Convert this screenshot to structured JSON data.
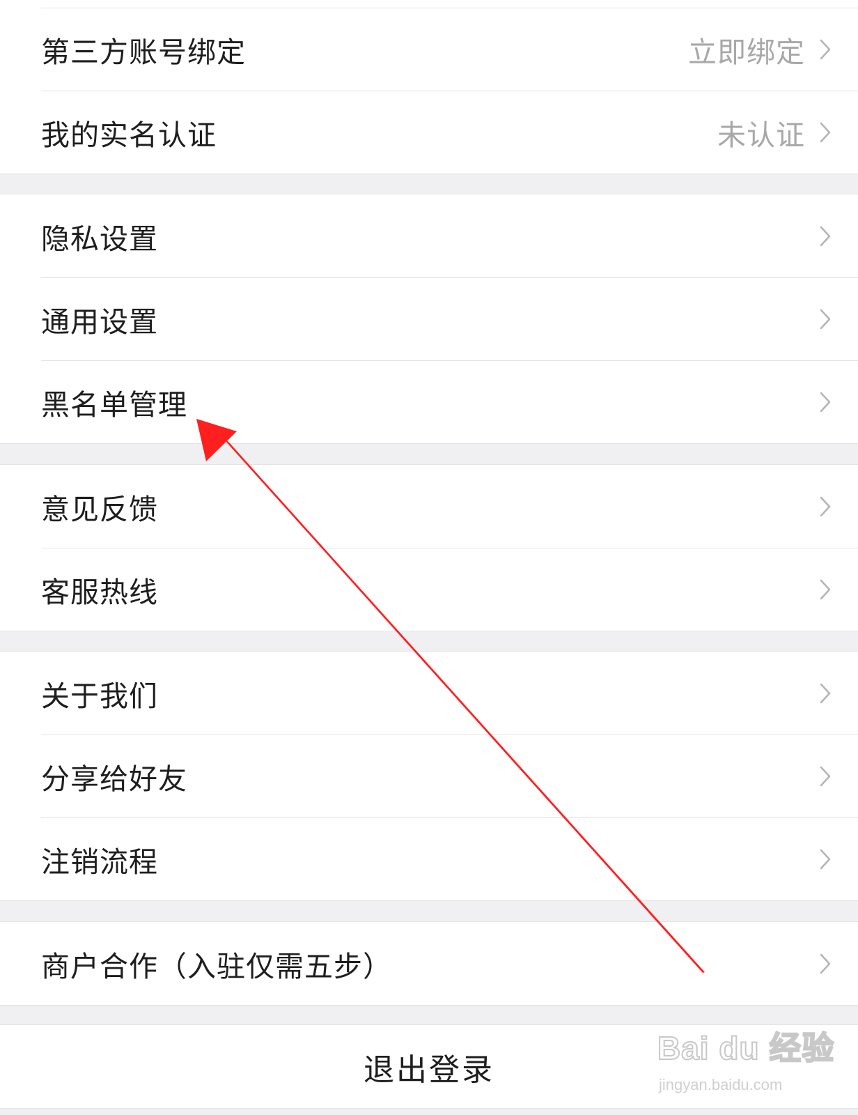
{
  "groups": [
    {
      "rows": [
        {
          "label": "第三方账号绑定",
          "value": "立即绑定"
        },
        {
          "label": "我的实名认证",
          "value": "未认证"
        }
      ]
    },
    {
      "rows": [
        {
          "label": "隐私设置"
        },
        {
          "label": "通用设置"
        },
        {
          "label": "黑名单管理"
        }
      ]
    },
    {
      "rows": [
        {
          "label": "意见反馈"
        },
        {
          "label": "客服热线"
        }
      ]
    },
    {
      "rows": [
        {
          "label": "关于我们"
        },
        {
          "label": "分享给好友"
        },
        {
          "label": "注销流程"
        }
      ]
    },
    {
      "rows": [
        {
          "label": "商户合作（入驻仅需五步）"
        }
      ]
    }
  ],
  "logout": {
    "label": "退出登录"
  },
  "annotation": {
    "color": "#ff1f1f",
    "points_to": "黑名单管理"
  },
  "watermark": {
    "brand": "Bai du 经验",
    "url": "jingyan.baidu.com"
  },
  "colors": {
    "background": "#f0f0f2",
    "row": "#ffffff",
    "text": "#1e1e1e",
    "secondary": "#a8a8a8",
    "chevron": "#b4b4b4"
  }
}
